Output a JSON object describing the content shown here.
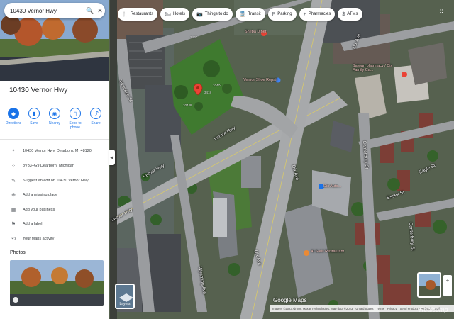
{
  "search": {
    "value": "10430 Vernor Hwy",
    "search_icon": "search-icon",
    "close_icon": "close-icon"
  },
  "place": {
    "title": "10430 Vernor Hwy",
    "actions": [
      {
        "label": "Directions",
        "icon": "directions-icon"
      },
      {
        "label": "Save",
        "icon": "bookmark-icon"
      },
      {
        "label": "Nearby",
        "icon": "nearby-icon"
      },
      {
        "label": "Send to phone",
        "icon": "phone-icon"
      },
      {
        "label": "Share",
        "icon": "share-icon"
      }
    ],
    "info": [
      {
        "text": "10430 Vernor Hwy, Dearborn, MI 48120",
        "icon": "location-pin-icon"
      },
      {
        "text": "8V33+G9 Dearborn, Michigan",
        "icon": "plus-code-icon"
      },
      {
        "text": "Suggest an edit on 10430 Vernor Hwy",
        "icon": "edit-icon"
      },
      {
        "text": "Add a missing place",
        "icon": "add-place-icon"
      },
      {
        "text": "Add your business",
        "icon": "business-icon"
      },
      {
        "text": "Add a label",
        "icon": "label-icon"
      },
      {
        "text": "Your Maps activity",
        "icon": "history-icon"
      }
    ],
    "photos_title": "Photos"
  },
  "chips": [
    {
      "label": "Restaurants",
      "icon": "restaurant-icon"
    },
    {
      "label": "Hotels",
      "icon": "hotel-icon"
    },
    {
      "label": "Things to do",
      "icon": "camera-icon"
    },
    {
      "label": "Transit",
      "icon": "transit-icon"
    },
    {
      "label": "Parking",
      "icon": "parking-icon"
    },
    {
      "label": "Pharmacies",
      "icon": "pharmacy-icon"
    },
    {
      "label": "ATMs",
      "icon": "atm-icon"
    }
  ],
  "map": {
    "roads": {
      "vernor_1": "Vernor Hwy",
      "vernor_2": "Vernor Hwy",
      "vernor_3": "Vernor Hwy",
      "dix_1": "Dix Ave",
      "dix_2": "Dix Ave",
      "dix_3": "Dix Ave",
      "waterloo": "Waterloo St",
      "wyoming": "Wyoming Ave",
      "canterbury": "Canterbury St",
      "canterbury_2": "Canterbury St",
      "eagle": "Eagle St",
      "essex": "Essex St"
    },
    "pois": {
      "sheba": "Sheba Diner",
      "dix_pharmacy": "Salwan pharmacy / Dix Family Ca...",
      "vernor_shop": "Vernor Shoe Repair",
      "dix_auto": "Dix Auto...",
      "al_sahil": "Al Sahil Restaurant"
    },
    "numbers": {
      "n1": "3407",
      "n2": "3418",
      "n3": "10448",
      "n4": "10474"
    }
  },
  "layers_label": "Layers",
  "google_logo": "Google Maps",
  "footer": {
    "imagery": "Imagery ©2023 Airbus, Maxar Technologies, Map data ©2023",
    "country": "United States",
    "terms": "Terms",
    "privacy": "Privacy",
    "feedback": "Send Product Feedback",
    "scale": "50 ft"
  },
  "feeds_collapse": "Feeds collapse",
  "watermark": "Realcomp",
  "colors": {
    "accent": "#1a73e8",
    "pin": "#ea4335"
  }
}
